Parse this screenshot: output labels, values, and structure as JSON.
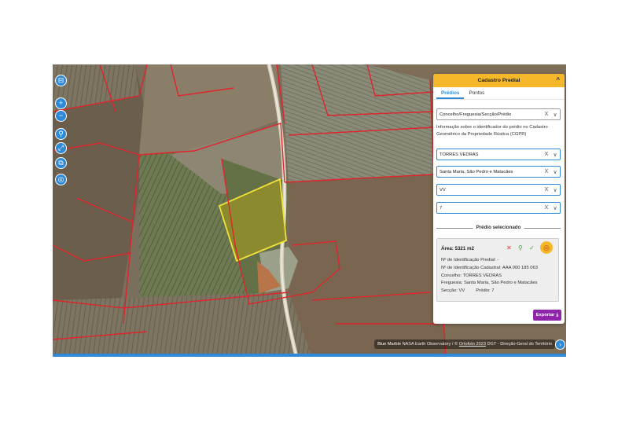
{
  "map": {
    "controls": [
      {
        "name": "layers-icon",
        "glyph": "⊟"
      },
      {
        "name": "zoom-in-icon",
        "glyph": "+"
      },
      {
        "name": "zoom-out-icon",
        "glyph": "−"
      },
      {
        "name": "location-pin-icon",
        "glyph": "⚲"
      },
      {
        "name": "measure-icon",
        "glyph": "⤢"
      },
      {
        "name": "print-icon",
        "glyph": "⧉"
      },
      {
        "name": "geolocate-icon",
        "glyph": "◎"
      }
    ],
    "attribution": {
      "strong": "Blue Marble",
      "provider": "NASA Earth Observatory / ©",
      "link": "Ortofoto 2023",
      "rest": "DGT - Direção-Geral do Território"
    },
    "colors": {
      "parcel_border": "#e0242c",
      "selected_parcel": "#f2e03a"
    }
  },
  "panel": {
    "title": "Cadastro Predial",
    "collapse_icon": "^",
    "tabs": [
      {
        "label": "Prédios",
        "active": true
      },
      {
        "label": "Pontos",
        "active": false
      }
    ],
    "search_mode": "Concelho/Freguesia/Secção/Prédio",
    "info": "Informação sobre o identificador do prédio no Cadastro Geométrico da Propriedade Rústica (CGPR)",
    "concelho": "TORRES VEDRAS",
    "freguesia": "Santa Maria, São Pedro e Matacães",
    "seccao": "VV",
    "predio": "7",
    "clear_glyph": "X",
    "dropdown_glyph": "∨",
    "selected_title": "Prédio selecionado",
    "card": {
      "area": "Área: 5321 m2",
      "id_predial": "Nº de Identificação Predial: -",
      "id_cadastral": "Nº de Identificação Cadastral: AAA 000 185 063",
      "concelho": "Concelho: TORRES VEDRAS",
      "freguesia": "Freguesia: Santa Maria, São Pedro e Matacães",
      "seccao": "Secção: VV",
      "predio": "Prédio: 7"
    },
    "export_label": "Exportar",
    "export_icon": "⤓",
    "accent": "#f5b82a",
    "primary": "#2e8ad6",
    "export_color": "#8e24aa"
  }
}
